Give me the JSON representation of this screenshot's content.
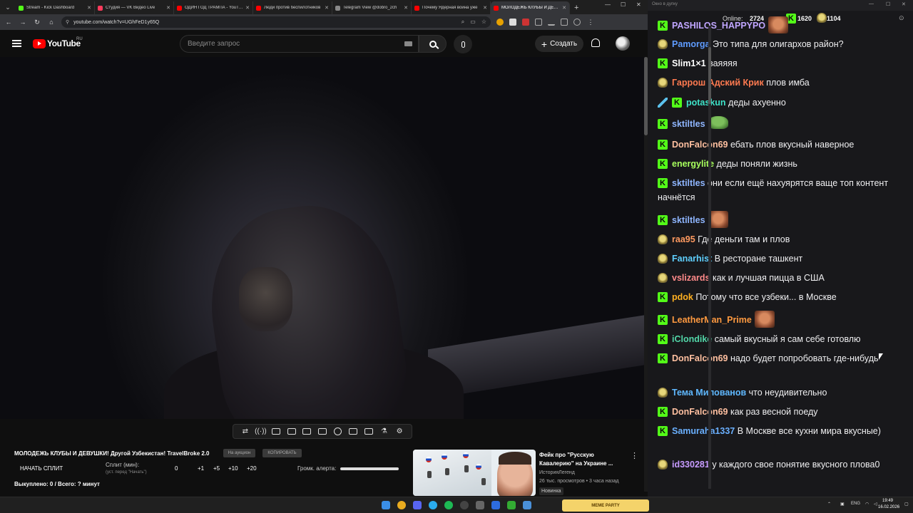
{
  "browser": {
    "tabs": [
      {
        "label": "Stream - Kick Dashboard",
        "color": "#53fc18"
      },
      {
        "label": "Студия — VK Видео Live",
        "color": "#ff3b5c"
      },
      {
        "label": "ОДИН ГОД ТРАМПА - YouTube",
        "color": "#ff0000"
      },
      {
        "label": "Люди против беспилотников",
        "color": "#ff0000"
      },
      {
        "label": "Telegram View @dobro_2ch",
        "color": "#888888"
      },
      {
        "label": "Почему Ядерная война уже",
        "color": "#ff0000"
      },
      {
        "label": "МОЛОДЕЖЬ КЛУБЫ И ДЕВУШ",
        "color": "#ff0000"
      }
    ],
    "url": "youtube.com/watch?v=UGhFeD1y65Q"
  },
  "youtube": {
    "logo_text": "YouTube",
    "country": "RU",
    "search_placeholder": "Введите запрос",
    "create_label": "Создать"
  },
  "video": {
    "title": "МОЛОДЕЖЬ КЛУБЫ И ДЕВУШКИ! Другой Узбекистан! TravelBroke 2.0",
    "pill1": "На аукцион",
    "pill2": "КОПИРОВАТЬ",
    "split_button": "НАЧАТЬ СПЛИТ",
    "split_label": "Сплит (мин):",
    "split_hint": "(уст. перед \"Начать\")",
    "split_values": [
      "0",
      "+1",
      "+5",
      "+10",
      "+20"
    ],
    "alert_volume_label": "Громк. алерта:",
    "alert_volume": 1.0,
    "bought": "Выкуплено: 0 / Всего: ? минут"
  },
  "recommended": {
    "title": "Фейк про \"Русскую Кавалерию\" на Украине ...",
    "channel": "ИсторияЛегенд",
    "meta": "26 тыс. просмотров • 3 часа назад",
    "badge": "Новинка"
  },
  "chat": {
    "window_title": "Окно в дупку",
    "online_label": "Online:",
    "online": "2724",
    "kick_count": "1620",
    "coin_count": "1104",
    "messages": [
      {
        "badge": "kick",
        "user": "PASHILOS_HAPPYPO",
        "color": "#c0a6ff",
        "text": "",
        "emote": "face"
      },
      {
        "badge": "coin",
        "user": "Pamorga",
        "color": "#5f9cff",
        "text": "Это типа для олигархов район?"
      },
      {
        "badge": "kick",
        "user": "Slim1×1",
        "color": "#ffffff",
        "text": "ваяяяя"
      },
      {
        "badge": "coin",
        "user": "Гаррош Адский Крик",
        "color": "#ff7a50",
        "text": "плов имба"
      },
      {
        "badge": "sword",
        "user": "potaskun",
        "color": "#3ee2c8",
        "text": "деды ахуенно"
      },
      {
        "badge": "kick",
        "user": "sktiltles",
        "color": "#8fb6ff",
        "text": "",
        "emote": "pepe"
      },
      {
        "badge": "kick",
        "user": "DonFalcon69",
        "color": "#ffc0a0",
        "text": "ебать плов вкусный наверное"
      },
      {
        "badge": "kick",
        "user": "energylite",
        "color": "#a8ff5e",
        "text": "деды поняли жизнь"
      },
      {
        "badge": "kick",
        "user": "sktiltles",
        "color": "#8fb6ff",
        "text": "они если ещё нахуярятся ваще топ контент начнётся"
      },
      {
        "badge": "kick",
        "user": "sktiltles",
        "color": "#8fb6ff",
        "text": "",
        "emote": "face"
      },
      {
        "badge": "coin",
        "user": "raa95",
        "color": "#ff9a60",
        "text": "Где деньги там и плов"
      },
      {
        "badge": "coin",
        "user": "Fanarhist",
        "color": "#5fd0ff",
        "text": "В ресторане ташкент"
      },
      {
        "badge": "coin",
        "user": "vslizards",
        "color": "#ff8a8a",
        "text": "как и лучшая пицца в США"
      },
      {
        "badge": "kick",
        "user": "pdok",
        "color": "#ffb020",
        "text": "Потому что все узбеки... в Москве"
      },
      {
        "badge": "kick",
        "user": "LeatherMan_Prime",
        "color": "#ff9a40",
        "text": "",
        "emote": "face"
      },
      {
        "badge": "kick",
        "user": "iClondike",
        "color": "#52d6a8",
        "text": "самый вкусный я сам себе готовлю"
      },
      {
        "badge": "kick",
        "user": "DonFalcon69",
        "color": "#ffc0a0",
        "text": "надо будет попробовать где-нибудь"
      },
      {
        "badge": "coin",
        "user": "Тема Милованов",
        "color": "#5fb8ff",
        "text": "что неудивительно"
      },
      {
        "badge": "kick",
        "user": "DonFalcon69",
        "color": "#ffc0a0",
        "text": "как раз весной поеду"
      },
      {
        "badge": "kick",
        "user": "Samuraha1337",
        "color": "#6ab0ff",
        "text": "В Москве все кухни мира вкусные)"
      },
      {
        "badge": "coin",
        "user": "id330281",
        "color": "#c79bff",
        "text": "у каждого свое понятие вкусного плова0"
      }
    ]
  },
  "taskbar": {
    "widget": "MEME PARTY",
    "lang": "ENG",
    "time": "19:49",
    "date": "16.02.2026"
  }
}
